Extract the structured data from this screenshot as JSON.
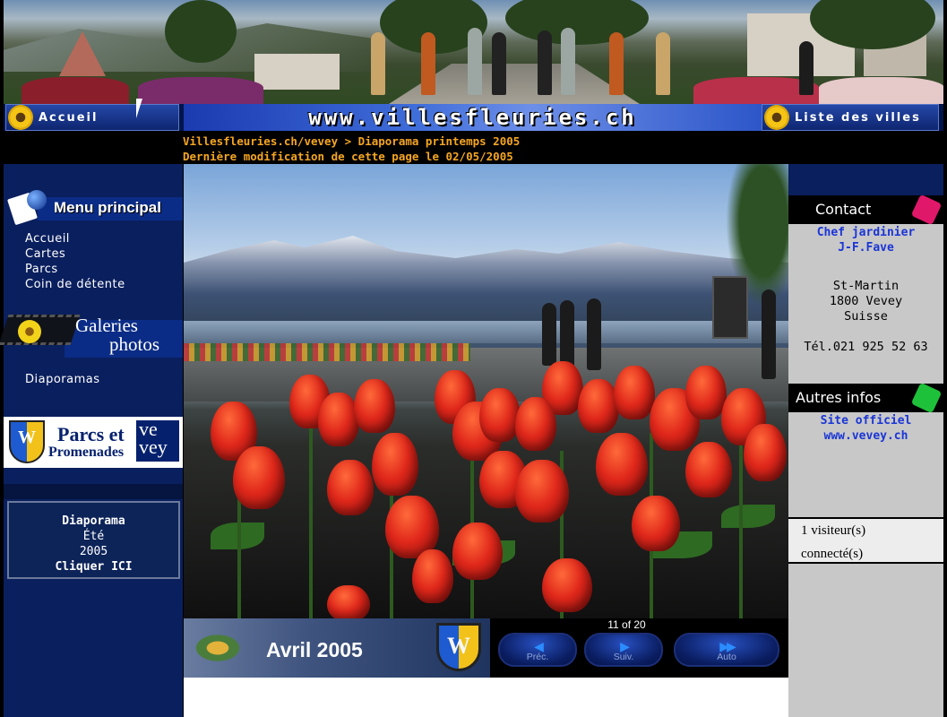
{
  "nav": {
    "home_label": "Accueil",
    "site_name": "www.villesfleuries.ch",
    "cities_label": "Liste des villes"
  },
  "breadcrumb": {
    "path": "Villesfleuries.ch/vevey > Diaporama printemps 2005",
    "modified": "Dernière modification de cette page le 02/05/2005"
  },
  "left": {
    "menu_title": "Menu principal",
    "menu_items": [
      "Accueil",
      "Cartes",
      "Parcs",
      "Coin de détente"
    ],
    "gallery_title_1": "Galeries",
    "gallery_title_2": "photos",
    "gallery_link": "Diaporamas",
    "parcs_banner": {
      "line1": "Parcs et",
      "line2": "Promenades",
      "city": "ve vey"
    },
    "diapo_box": {
      "line1": "Diaporama",
      "line2": "Été",
      "line3": "2005",
      "line4": "Cliquer ICI"
    }
  },
  "slideshow": {
    "caption": "Avril 2005",
    "counter": "11 of 20",
    "prev_label": "Préc.",
    "next_label": "Suiv.",
    "auto_label": "Auto",
    "shield_letter": "W"
  },
  "right": {
    "contact_title": "Contact",
    "gardener_1": "Chef jardinier",
    "gardener_2": "J-F.Fave",
    "address_1": "St-Martin",
    "address_2": "1800 Vevey",
    "address_3": "Suisse",
    "phone": "Tél.021 925 52 63",
    "other_title": "Autres infos",
    "official_1": "Site officiel",
    "official_2": "www.vevey.ch",
    "visitors_1": "1 visiteur(s)",
    "visitors_2": "connecté(s)"
  },
  "colors": {
    "breadcrumb": "#f5a623",
    "link_blue": "#1a35d6",
    "sidebar_blue": "#0a1f5e"
  }
}
